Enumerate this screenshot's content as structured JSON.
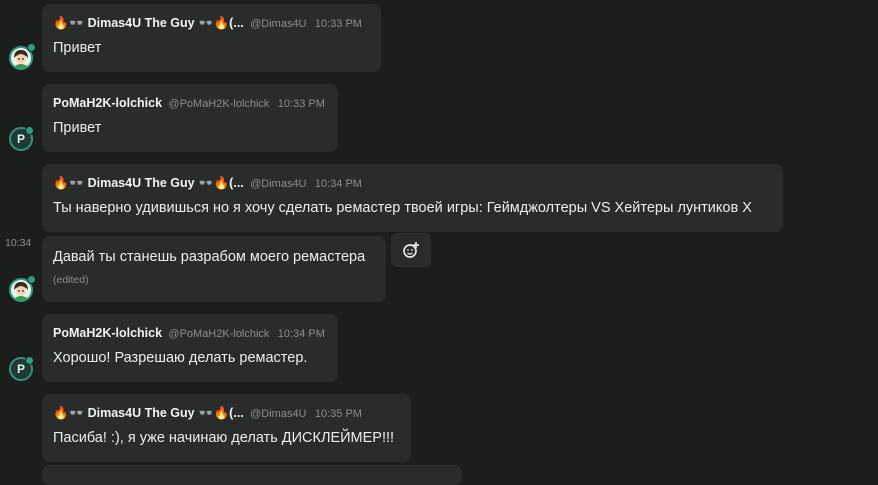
{
  "messages": [
    {
      "author": "🔥👓 Dimas4U The Guy 👓🔥(...",
      "handle": "@Dimas4U",
      "time": "10:33 PM",
      "text": "Привет"
    },
    {
      "author": "PoMaH2K-lolchick",
      "handle": "@PoMaH2K-lolchick",
      "time": "10:33 PM",
      "text": "Привет"
    },
    {
      "author": "🔥👓 Dimas4U The Guy 👓🔥(...",
      "handle": "@Dimas4U",
      "time": "10:34 PM",
      "text": "Ты наверно удивишься но я хочу сделать ремастер твоей игры: Геймджолтеры VS Хейтеры лунтиков Х"
    },
    {
      "text": "Давай ты станешь разрабом моего ремастера",
      "edited": "(edited)",
      "side_time": "10:34"
    },
    {
      "author": "PoMaH2K-lolchick",
      "handle": "@PoMaH2K-lolchick",
      "time": "10:34 PM",
      "text": "Хорошо! Разрешаю делать ремастер."
    },
    {
      "author": "🔥👓 Dimas4U The Guy 👓🔥(...",
      "handle": "@Dimas4U",
      "time": "10:35 PM",
      "text": "Пасиба! :), я уже начинаю делать ДИСКЛЕЙМЕР!!!"
    }
  ],
  "avatar_letter": "P",
  "icons": {
    "reaction": "add-reaction-icon",
    "avatar1": "girl-avatar-icon"
  },
  "colors": {
    "bg": "#1c1e1e",
    "bubble": "#2a2c2c",
    "accent": "#2d9c85"
  }
}
